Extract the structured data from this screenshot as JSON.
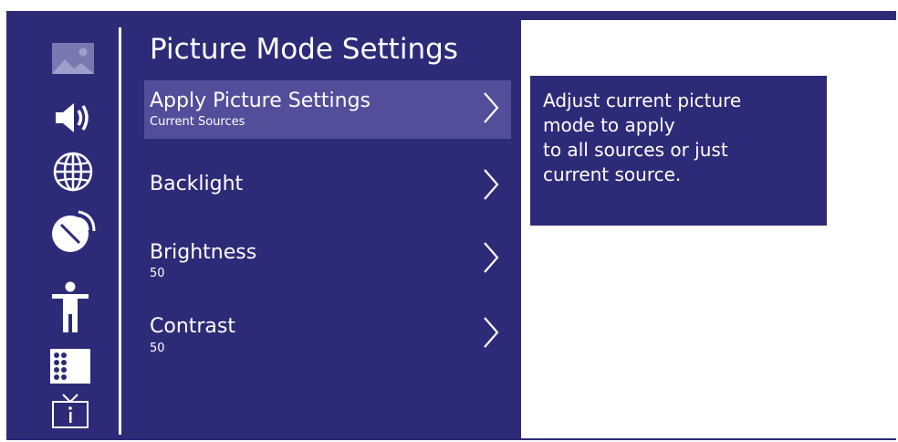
{
  "colors": {
    "panel_bg": "#2d2b78",
    "selected_bg": "#524e9a",
    "text": "#ffffff",
    "content_bg": "#ffffff"
  },
  "sidebar": {
    "icons": [
      "picture-icon",
      "speaker-icon",
      "globe-icon",
      "satellite-dish-icon",
      "accessibility-icon",
      "apps-grid-icon",
      "tv-info-icon"
    ],
    "selected_icon": "picture-icon"
  },
  "menu": {
    "title": "Picture Mode Settings",
    "items": [
      {
        "label": "Apply Picture Settings",
        "sub": "Current Sources",
        "selected": true
      },
      {
        "label": "Backlight",
        "sub": ""
      },
      {
        "label": "Brightness",
        "sub": "50"
      },
      {
        "label": "Contrast",
        "sub": "50"
      }
    ]
  },
  "info": {
    "text": "Adjust current picture\nmode to apply\nto all sources or just\ncurrent source."
  }
}
